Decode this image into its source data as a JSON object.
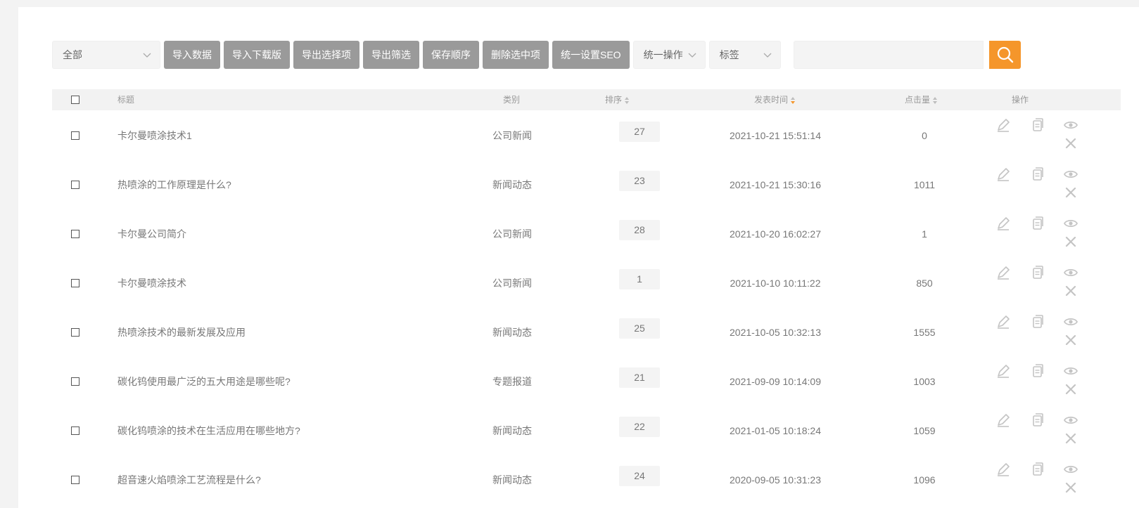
{
  "toolbar": {
    "category_select": "全部",
    "buttons": [
      "导入数据",
      "导入下载版",
      "导出选择项",
      "导出筛选",
      "保存顺序",
      "删除选中项",
      "统一设置SEO"
    ],
    "bulk_select": "统一操作",
    "tag_select": "标签",
    "search_value": ""
  },
  "table": {
    "headers": {
      "title": "标题",
      "category": "类别",
      "order": "排序",
      "publish_time": "发表时间",
      "clicks": "点击量",
      "actions": "操作"
    },
    "rows": [
      {
        "title": "卡尔曼喷涂技术1",
        "category": "公司新闻",
        "order": "27",
        "time": "2021-10-21 15:51:14",
        "clicks": "0"
      },
      {
        "title": "热喷涂的工作原理是什么?",
        "category": "新闻动态",
        "order": "23",
        "time": "2021-10-21 15:30:16",
        "clicks": "1011"
      },
      {
        "title": "卡尔曼公司简介",
        "category": "公司新闻",
        "order": "28",
        "time": "2021-10-20 16:02:27",
        "clicks": "1"
      },
      {
        "title": "卡尔曼喷涂技术",
        "category": "公司新闻",
        "order": "1",
        "time": "2021-10-10 10:11:22",
        "clicks": "850"
      },
      {
        "title": "热喷涂技术的最新发展及应用",
        "category": "新闻动态",
        "order": "25",
        "time": "2021-10-05 10:32:13",
        "clicks": "1555"
      },
      {
        "title": "碳化钨使用最广泛的五大用途是哪些呢?",
        "category": "专题报道",
        "order": "21",
        "time": "2021-09-09 10:14:09",
        "clicks": "1003"
      },
      {
        "title": "碳化钨喷涂的技术在生活应用在哪些地方?",
        "category": "新闻动态",
        "order": "22",
        "time": "2021-01-05 10:18:24",
        "clicks": "1059"
      },
      {
        "title": "超音速火焰喷涂工艺流程是什么?",
        "category": "新闻动态",
        "order": "24",
        "time": "2020-09-05 10:31:23",
        "clicks": "1096"
      }
    ],
    "row_actions": [
      "edit-icon",
      "copy-icon",
      "view-icon",
      "delete-icon"
    ]
  },
  "colors": {
    "accent": "#f5962b",
    "button_gray": "#9a9a9a",
    "header_bg": "#f2f2f2",
    "icon_gray": "#c4c4c4"
  }
}
